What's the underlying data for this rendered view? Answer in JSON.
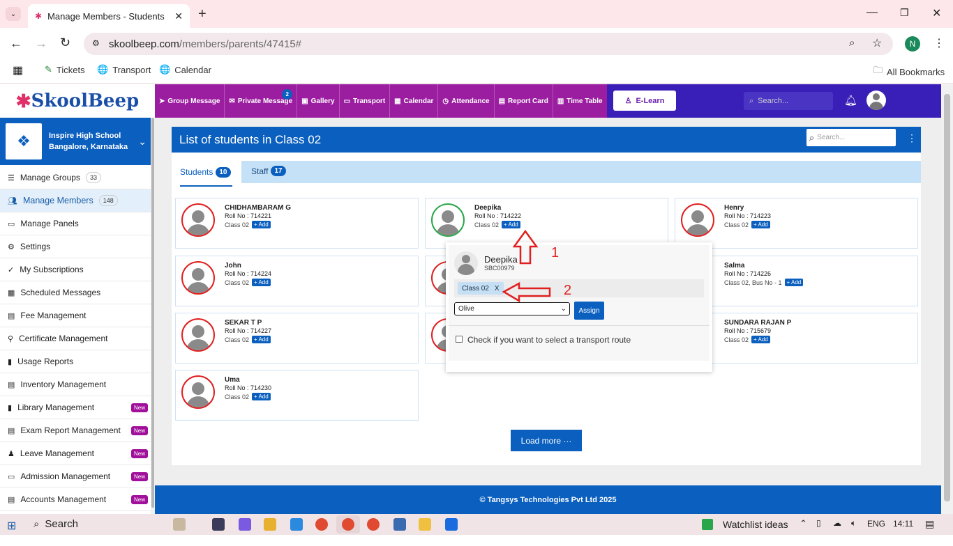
{
  "browser": {
    "tab_title": "Manage Members - Students",
    "url_host": "skoolbeep.com",
    "url_path": "/members/parents/47415#",
    "profile_initial": "N",
    "bookmarks": [
      "Tickets",
      "Transport",
      "Calendar"
    ],
    "all_bookmarks": "All Bookmarks"
  },
  "app": {
    "logo": "SkoolBeep",
    "nav": [
      {
        "label": "Group Message"
      },
      {
        "label": "Private Message",
        "badge": "2"
      },
      {
        "label": "Gallery"
      },
      {
        "label": "Transport"
      },
      {
        "label": "Calendar"
      },
      {
        "label": "Attendance"
      },
      {
        "label": "Report Card"
      },
      {
        "label": "Time Table"
      }
    ],
    "elearn": "E-Learn",
    "search_placeholder": "Search..."
  },
  "school": {
    "name": "Inspire High School",
    "location": "Bangalore, Karnataka"
  },
  "sidebar": [
    {
      "label": "Manage Groups",
      "count": "33"
    },
    {
      "label": "Manage Members",
      "count": "148",
      "active": true
    },
    {
      "label": "Manage Panels"
    },
    {
      "label": "Settings"
    },
    {
      "label": "My Subscriptions"
    },
    {
      "label": "Scheduled Messages"
    },
    {
      "label": "Fee Management"
    },
    {
      "label": "Certificate Management"
    },
    {
      "label": "Usage Reports"
    },
    {
      "label": "Inventory Management"
    },
    {
      "label": "Library Management",
      "new": "New"
    },
    {
      "label": "Exam Report Management",
      "new": "New"
    },
    {
      "label": "Leave Management",
      "new": "New"
    },
    {
      "label": "Admission Management",
      "new": "New"
    },
    {
      "label": "Accounts Management",
      "new": "New"
    }
  ],
  "main": {
    "title": "List of students in Class 02",
    "search_placeholder": "Search...",
    "tabs": [
      {
        "label": "Students",
        "count": "10"
      },
      {
        "label": "Staff",
        "count": "17"
      }
    ],
    "add_label": "+ Add",
    "load_more": "Load more ···",
    "students": [
      {
        "name": "CHIDHAMBARAM G",
        "roll": "Roll No : 714221",
        "class": "Class 02"
      },
      {
        "name": "Deepika",
        "roll": "Roll No : 714222",
        "class": "Class 02"
      },
      {
        "name": "Henry",
        "roll": "Roll No : 714223",
        "class": "Class 02"
      },
      {
        "name": "John",
        "roll": "Roll No : 714224",
        "class": "Class 02"
      },
      {
        "name": "Salma",
        "roll": "Roll No : 714226",
        "class": "Class 02, Bus No - 1"
      },
      {
        "name": "SEKAR T P",
        "roll": "Roll No : 714227",
        "class": "Class 02"
      },
      {
        "name": "SUNDARA RAJAN P",
        "roll": "Roll No : 715679",
        "class": "Class 02"
      },
      {
        "name": "Uma",
        "roll": "Roll No : 714230",
        "class": "Class 02"
      }
    ]
  },
  "popup": {
    "name": "Deepika",
    "id": "SBC00979",
    "class_tag": "Class 02",
    "remove": "X",
    "select_value": "Olive",
    "assign": "Assign",
    "transport_label": "Check if you want to select a transport route"
  },
  "annotations": {
    "one": "1",
    "two": "2"
  },
  "footer": "© Tangsys Technologies Pvt Ltd 2025",
  "taskbar": {
    "search": "Search",
    "watchlist": "Watchlist ideas",
    "lang": "ENG",
    "time": "14:11"
  },
  "colors": {
    "primary": "#0a5fbf",
    "header": "#3a1eb8",
    "nav": "#9b1ea0",
    "red": "#e02020"
  }
}
